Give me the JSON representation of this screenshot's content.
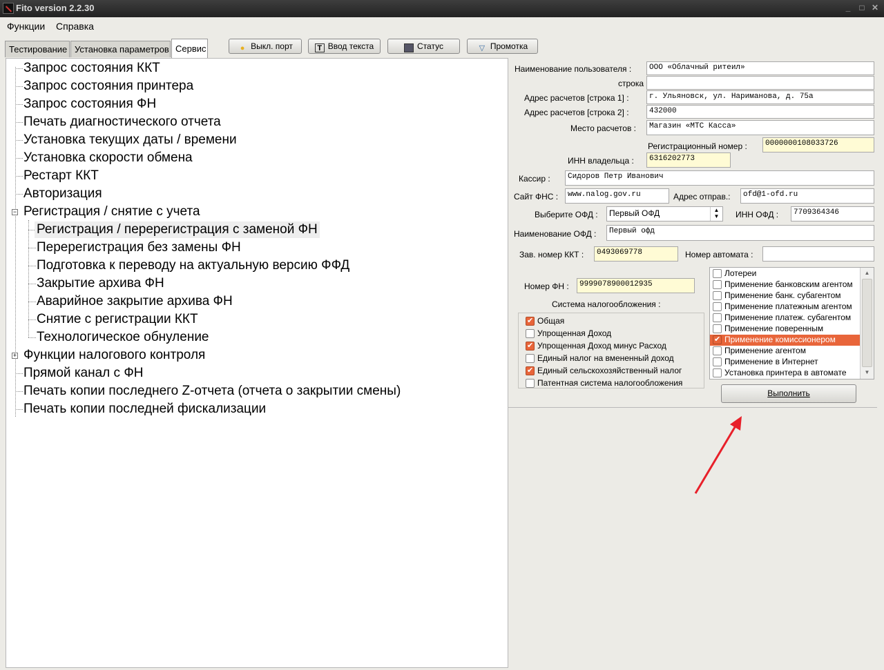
{
  "window": {
    "title": "Fito version 2.2.30",
    "controls": [
      "_",
      "□",
      "✕"
    ]
  },
  "menu": [
    "Функции",
    "Справка"
  ],
  "tabs": [
    "Тестирование",
    "Установка параметров",
    "Сервис"
  ],
  "toolbar": {
    "port": "Выкл. порт",
    "text_input": "Ввод текста",
    "status": "Статус",
    "feed": "Промотка"
  },
  "tree": {
    "items": [
      "Запрос состояния ККТ",
      "Запрос состояния принтера",
      "Запрос состояния ФН",
      "Печать диагностического отчета",
      "Установка текущих даты / времени",
      "Установка скорости обмена",
      "Рестарт ККТ",
      "Авторизация",
      "Регистрация / снятие с учета",
      "Функции налогового контроля",
      "Прямой канал с ФН",
      "Печать копии последнего Z-отчета (отчета о закрытии смены)",
      "Печать копии последней фискализации"
    ],
    "children": [
      "Регистрация / перерегистрация с заменой ФН",
      "Перерегистрация без замены ФН",
      "Подготовка к переводу на актуальную версию ФФД",
      "Закрытие архива ФН",
      "Аварийное закрытие архива ФН",
      "Снятие с регистрации ККТ",
      "Технологическое обнуление"
    ]
  },
  "form": {
    "user_name_label": "Наименование пользователя :",
    "user_name": "ООО «Облачный ритеил»",
    "line2_label": "строка 2 :",
    "line2": "",
    "addr1_label": "Адрес расчетов [строка 1] :",
    "addr1": "г. Ульяновск, ул. Нариманова, д. 75а",
    "addr2_label": "Адрес расчетов [строка 2] :",
    "addr2": "432000",
    "place_label": "Место расчетов :",
    "place": "Магазин «МТС Касса»",
    "reg_label": "Регистрационный номер :",
    "reg": "0000000108033726",
    "inn_label": "ИНН владельца :",
    "inn": "6316202773",
    "cashier_label": "Кассир :",
    "cashier": "Сидоров Петр Иванович",
    "fns_label": "Сайт ФНС :",
    "fns": "www.nalog.gov.ru",
    "sender_label": "Адрес отправ.:",
    "sender": "ofd@1-ofd.ru",
    "ofd_select_label": "Выберите ОФД :",
    "ofd_select": "Первый ОФД",
    "ofd_inn_label": "ИНН ОФД :",
    "ofd_inn": "7709364346",
    "ofd_name_label": "Наименование ОФД :",
    "ofd_name": "Первый офд",
    "kkt_label": "Зав. номер ККТ :",
    "kkt": "0493069778",
    "automat_label": "Номер автомата :",
    "automat": "",
    "fn_label": "Номер ФН :",
    "fn": "9999078900012935",
    "tax_label": "Система налогообложения :"
  },
  "tax": [
    {
      "label": "Общая",
      "checked": true
    },
    {
      "label": "Упрощенная Доход",
      "checked": false
    },
    {
      "label": "Упрощенная Доход минус Расход",
      "checked": true
    },
    {
      "label": "Единый налог на вмененный доход",
      "checked": false
    },
    {
      "label": "Единый сельскохозяйственный налог",
      "checked": true
    },
    {
      "label": "Патентная система налогообложения",
      "checked": false
    }
  ],
  "signs": [
    {
      "label": "Лотереи",
      "checked": false
    },
    {
      "label": "Применение банковским агентом",
      "checked": false
    },
    {
      "label": "Применение банк. субагентом",
      "checked": false
    },
    {
      "label": "Применение платежным агентом",
      "checked": false
    },
    {
      "label": "Применение платеж. субагентом",
      "checked": false
    },
    {
      "label": "Применение поверенным",
      "checked": false
    },
    {
      "label": "Применение комиссионером",
      "checked": true
    },
    {
      "label": "Применение агентом",
      "checked": false
    },
    {
      "label": "Применение в Интернет",
      "checked": false
    },
    {
      "label": "Установка принтера в автомате",
      "checked": false
    }
  ],
  "execute": "Выполнить",
  "colors": {
    "accent": "#e8653a",
    "highlight": "#fffbd5",
    "arrow": "#e8202a"
  }
}
